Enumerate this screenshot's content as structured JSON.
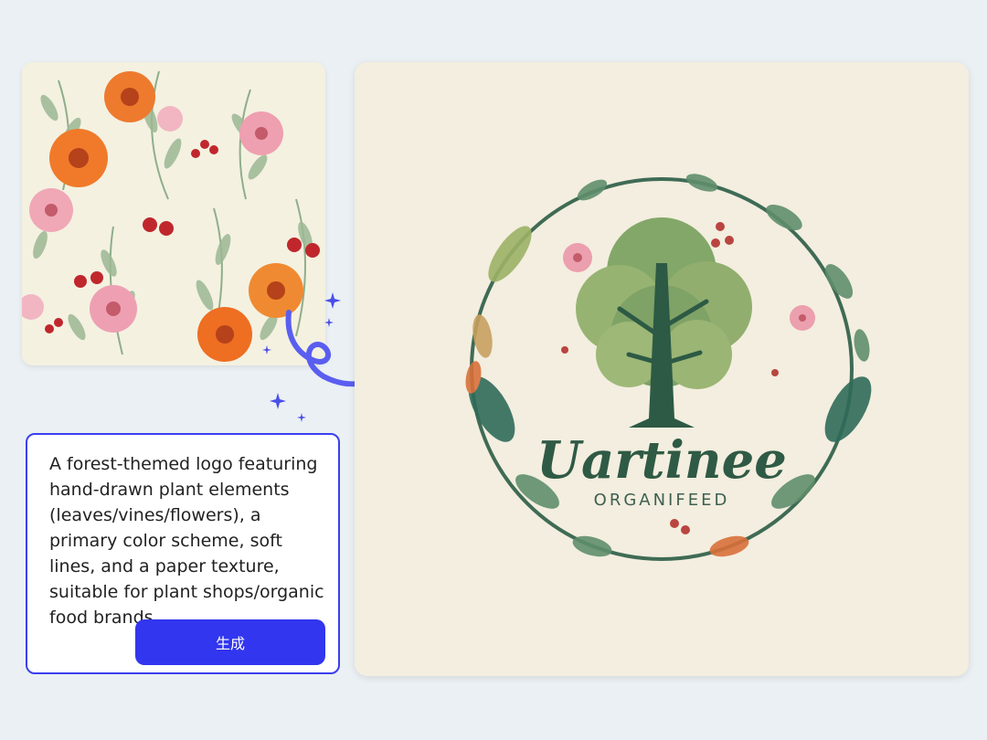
{
  "reference_image": {
    "icon": "floral-pattern-image"
  },
  "prompt": {
    "text": "A forest-themed logo featuring hand-drawn plant elements (leaves/vines/flowers), a primary color scheme, soft lines, and a paper texture, suitable for plant shops/organic food brands."
  },
  "generate_button": {
    "label": "生成"
  },
  "result_image": {
    "icon": "watercolor-tree-logo",
    "logo_title": "Uartinee",
    "logo_subtitle": "ORGANIFEED"
  },
  "colors": {
    "accent": "#3236ee",
    "background": "#eaf0f3",
    "paper": "#f3eedf"
  }
}
